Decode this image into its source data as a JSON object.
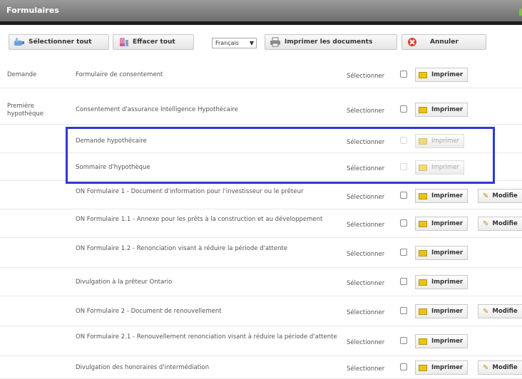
{
  "window": {
    "title": "Formulaires",
    "accent_color": "#7cc240"
  },
  "toolbar": {
    "select_all": {
      "label": "Sélectionner tout",
      "icon": "hand-pointer-icon"
    },
    "clear_all": {
      "label": "Effacer tout",
      "icon": "eraser-icon"
    },
    "language": {
      "selected": "Français"
    },
    "print_docs": {
      "label": "Imprimer les documents",
      "icon": "printer-icon"
    },
    "cancel": {
      "label": "Annuler",
      "icon": "cancel-icon"
    }
  },
  "labels": {
    "select": "Sélectionner",
    "print": "Imprimer",
    "modify": "Modifie"
  },
  "rows": [
    {
      "category": "Demande",
      "form": "Formulaire de consentement",
      "enabled": true,
      "modify": false
    },
    {
      "category": "Première hypothèque",
      "form": "Consentement d'assurance Intelligence Hypothécaire",
      "enabled": true,
      "modify": false
    },
    {
      "category": "",
      "form": "Demande hypothécaire",
      "enabled": false,
      "modify": false
    },
    {
      "category": "",
      "form": "Sommaire d'hypothèque",
      "enabled": false,
      "modify": false
    },
    {
      "category": "",
      "form": "ON Formulaire 1 - Document d'information pour l'investisseur ou le prêteur",
      "enabled": true,
      "modify": true
    },
    {
      "category": "",
      "form": "ON Formulaire 1.1 - Annexe pour les prêts à la construction et au développement",
      "enabled": true,
      "modify": true
    },
    {
      "category": "",
      "form": "ON Formulaire 1.2 - Renonciation visant à réduire la période d'attente",
      "enabled": true,
      "modify": false
    },
    {
      "category": "",
      "form": "Divulgation à la prêteur Ontario",
      "enabled": true,
      "modify": false
    },
    {
      "category": "",
      "form": "ON Formulaire 2 - Document de renouvellement",
      "enabled": true,
      "modify": true
    },
    {
      "category": "",
      "form": "ON Formulaire 2.1 - Renouvellement renonciation visant à réduire la période d'attente",
      "enabled": true,
      "modify": false
    },
    {
      "category": "",
      "form": "Divulgation des honoraires d'intermédiation",
      "enabled": true,
      "modify": true
    }
  ],
  "highlight_color": "#2d3ad6"
}
